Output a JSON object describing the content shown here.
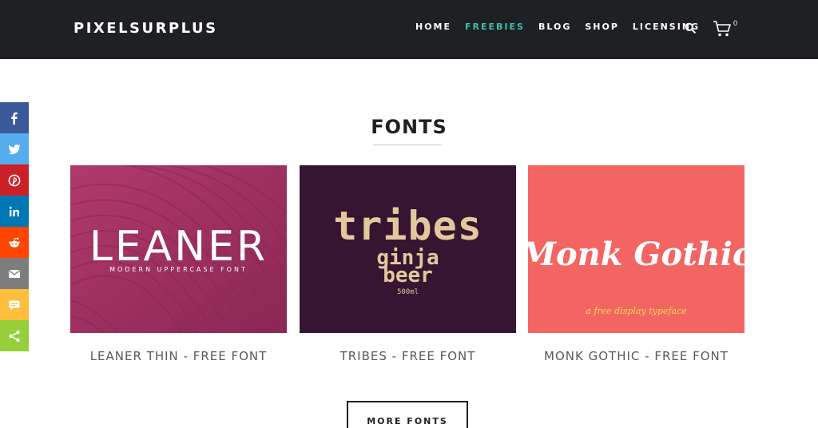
{
  "header": {
    "logo": "PIXELSURPLUS",
    "nav": [
      "HOME",
      "FREEBIES",
      "BLOG",
      "SHOP",
      "LICENSING"
    ],
    "active_nav": "FREEBIES",
    "cart_count": "0",
    "accent_color": "#3fbfad",
    "bar_color": "#1e2023"
  },
  "share": {
    "items": [
      {
        "icon": "facebook-icon",
        "color": "#3b5998"
      },
      {
        "icon": "twitter-icon",
        "color": "#55acee"
      },
      {
        "icon": "pinterest-icon",
        "color": "#cb2027"
      },
      {
        "icon": "linkedin-icon",
        "color": "#0077b5"
      },
      {
        "icon": "reddit-icon",
        "color": "#ff4500"
      },
      {
        "icon": "email-icon",
        "color": "#7d7d7d"
      },
      {
        "icon": "sms-icon",
        "color": "#ffbe3d"
      },
      {
        "icon": "share-icon",
        "color": "#95d03a"
      }
    ]
  },
  "section": {
    "title": "FONTS",
    "cards": [
      {
        "caption": "LEANER THIN - FREE FONT",
        "thumb_title": "LEANER",
        "thumb_sub": "MODERN UPPERCASE FONT",
        "bg": "#a1305f"
      },
      {
        "caption": "TRIBES - FREE FONT",
        "thumb_title": "tribes",
        "thumb_line2": "ginja",
        "thumb_line3": "beer",
        "thumb_small": "500ml",
        "bg": "#361532"
      },
      {
        "caption": "MONK GOTHIC - FREE FONT",
        "thumb_title": "Monk Gothic",
        "thumb_sub": "a free display typeface",
        "bg": "#f36563"
      }
    ],
    "more_button": "MORE FONTS"
  }
}
